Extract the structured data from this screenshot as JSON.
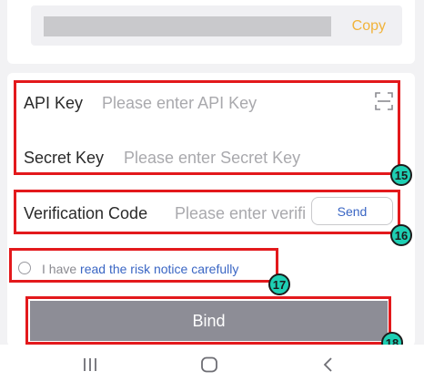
{
  "address_row": {
    "copy_label": "Copy"
  },
  "api_key": {
    "label": "API Key",
    "placeholder": "Please enter API Key"
  },
  "secret_key": {
    "label": "Secret Key",
    "placeholder": "Please enter Secret Key"
  },
  "verification": {
    "label": "Verification Code",
    "placeholder": "Please enter verifi",
    "send_label": "Send"
  },
  "risk_notice": {
    "prefix": "I have ",
    "link": "read the risk notice carefully",
    "checked": false
  },
  "bind_button": {
    "label": "Bind"
  },
  "annotations": [
    "15",
    "16",
    "17",
    "18"
  ],
  "icons": [
    "scan-icon",
    "recent-apps-icon",
    "home-icon",
    "back-icon"
  ],
  "colors": {
    "accent_copy": "#f1b33a",
    "link": "#3a66c4",
    "annotation_box": "#e3191c",
    "badge": "#1ecfb3",
    "bind_button": "#8d8d96"
  }
}
